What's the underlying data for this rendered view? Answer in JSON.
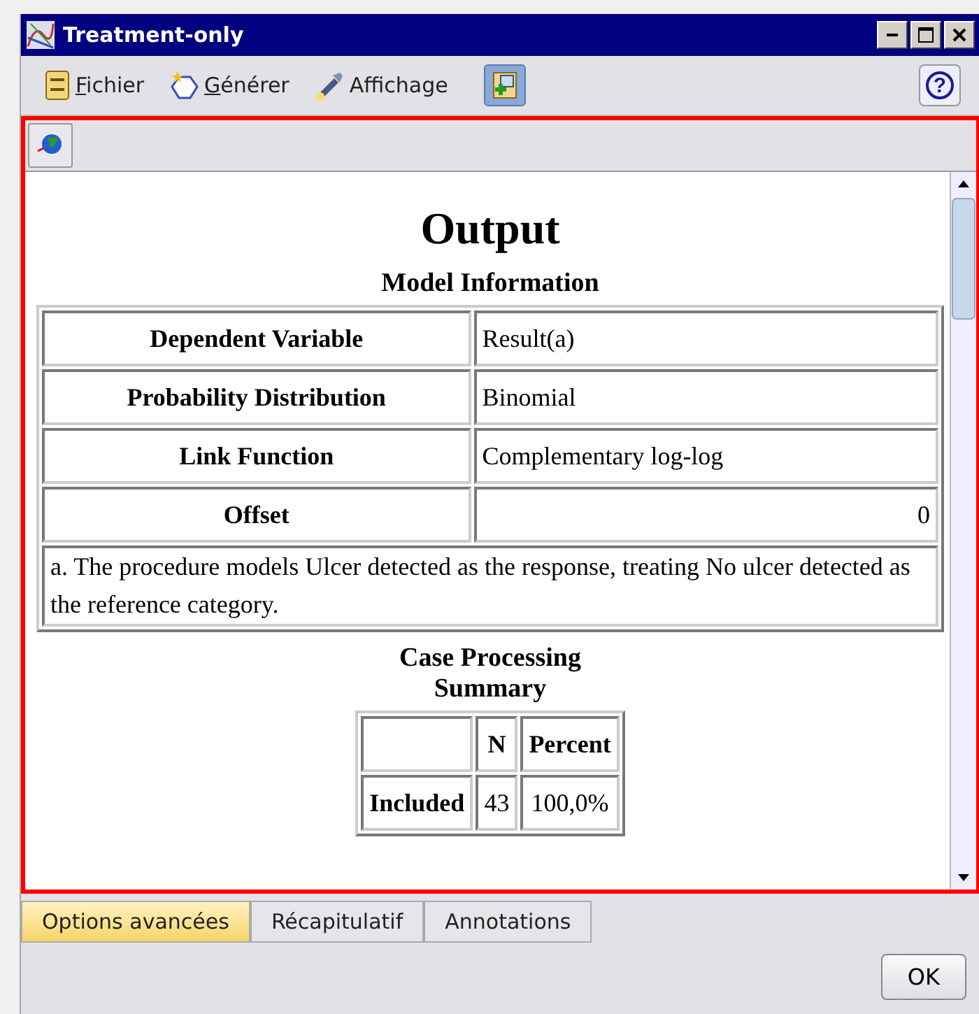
{
  "window": {
    "title": "Treatment-only"
  },
  "menu": [
    {
      "label": "Fichier",
      "mnemonic_first": true
    },
    {
      "label": "Générer",
      "mnemonic_first": true
    },
    {
      "label": "Affichage",
      "mnemonic_first": false
    }
  ],
  "help_button": "?",
  "output": {
    "title": "Output",
    "model_information": {
      "title": "Model Information",
      "rows": [
        {
          "label": "Dependent Variable",
          "value": "Result(a)",
          "kind": "text"
        },
        {
          "label": "Probability Distribution",
          "value": "Binomial",
          "kind": "text"
        },
        {
          "label": "Link Function",
          "value": "Complementary log-log",
          "kind": "text"
        },
        {
          "label": "Offset",
          "value": "0",
          "kind": "number"
        }
      ],
      "footnote": "a. The procedure models Ulcer detected as the response, treating No ulcer detected as the reference category."
    },
    "case_processing": {
      "title": "Case Processing Summary",
      "columns": [
        "N",
        "Percent"
      ],
      "rows": [
        {
          "label": "Included",
          "values": [
            "43",
            "100,0%"
          ]
        }
      ]
    }
  },
  "tabs": [
    {
      "label": "Options avancées",
      "selected": true
    },
    {
      "label": "Récapitulatif",
      "selected": false
    },
    {
      "label": "Annotations",
      "selected": false
    }
  ],
  "buttons": [
    "OK"
  ]
}
